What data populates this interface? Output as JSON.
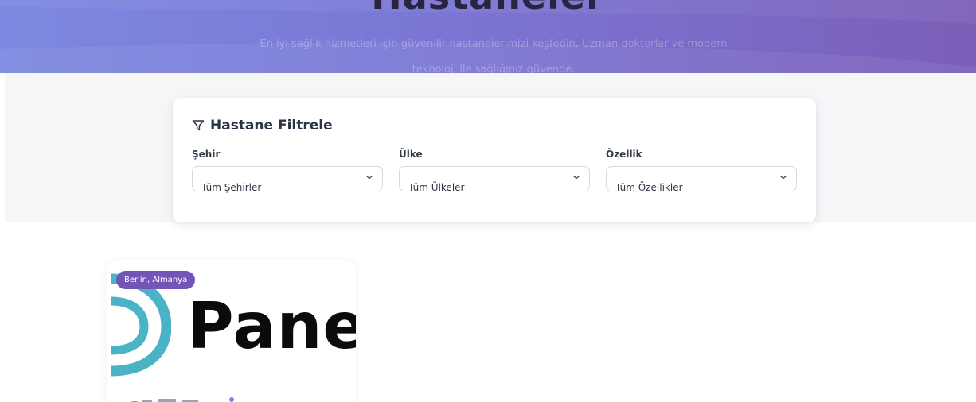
{
  "hero": {
    "title": "Hastaneler",
    "subtitle": "En iyi sağlık hizmetleri için güvenilir hastanelerimizi keşfedin. Uzman doktorlar ve modern teknoloji ile sağlığınız güvende."
  },
  "filter": {
    "icon": "funnel-icon",
    "title": "Hastane Filtrele",
    "fields": [
      {
        "label": "Şehir",
        "value": "Tüm Şehirler"
      },
      {
        "label": "Ülke",
        "value": "Tüm Ülkeler"
      },
      {
        "label": "Özellik",
        "value": "Tüm Özellikler"
      }
    ]
  },
  "hospitals": [
    {
      "location": "Berlin, Almanya",
      "logo_text": "Pane",
      "logo_color": "#4bb3c6"
    }
  ],
  "colors": {
    "hero_start": "#7c89e1",
    "hero_end": "#7b5fb8",
    "badge": "#7355b8"
  }
}
